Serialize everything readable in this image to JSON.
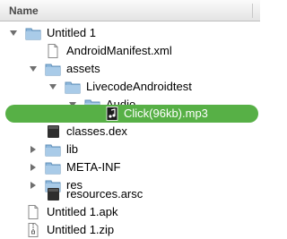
{
  "header": {
    "name_label": "Name"
  },
  "rows": [
    {
      "label": "Untitled 1",
      "icon": "folder-icon",
      "disclosure": "expanded"
    },
    {
      "label": "AndroidManifest.xml",
      "icon": "document-icon",
      "disclosure": "none"
    },
    {
      "label": "assets",
      "icon": "folder-icon",
      "disclosure": "expanded"
    },
    {
      "label": "LivecodeAndroidtest",
      "icon": "folder-icon",
      "disclosure": "expanded"
    },
    {
      "label": "Audio",
      "icon": "folder-icon",
      "disclosure": "expanded"
    },
    {
      "label": "Click(96kb).mp3",
      "icon": "audio-file-icon",
      "disclosure": "none",
      "selected": true
    },
    {
      "label": "classes.dex",
      "icon": "binary-file-icon",
      "disclosure": "none"
    },
    {
      "label": "lib",
      "icon": "folder-icon",
      "disclosure": "collapsed"
    },
    {
      "label": "META-INF",
      "icon": "folder-icon",
      "disclosure": "collapsed"
    },
    {
      "label": "res",
      "icon": "folder-icon",
      "disclosure": "collapsed"
    },
    {
      "label": "resources.arsc",
      "icon": "binary-file-icon",
      "disclosure": "none"
    },
    {
      "label": "Untitled 1.apk",
      "icon": "document-icon",
      "disclosure": "none"
    },
    {
      "label": "Untitled 1.zip",
      "icon": "zip-archive-icon",
      "disclosure": "none"
    }
  ],
  "colors": {
    "selection": "#57b046",
    "folder": "#8fb8dc"
  }
}
